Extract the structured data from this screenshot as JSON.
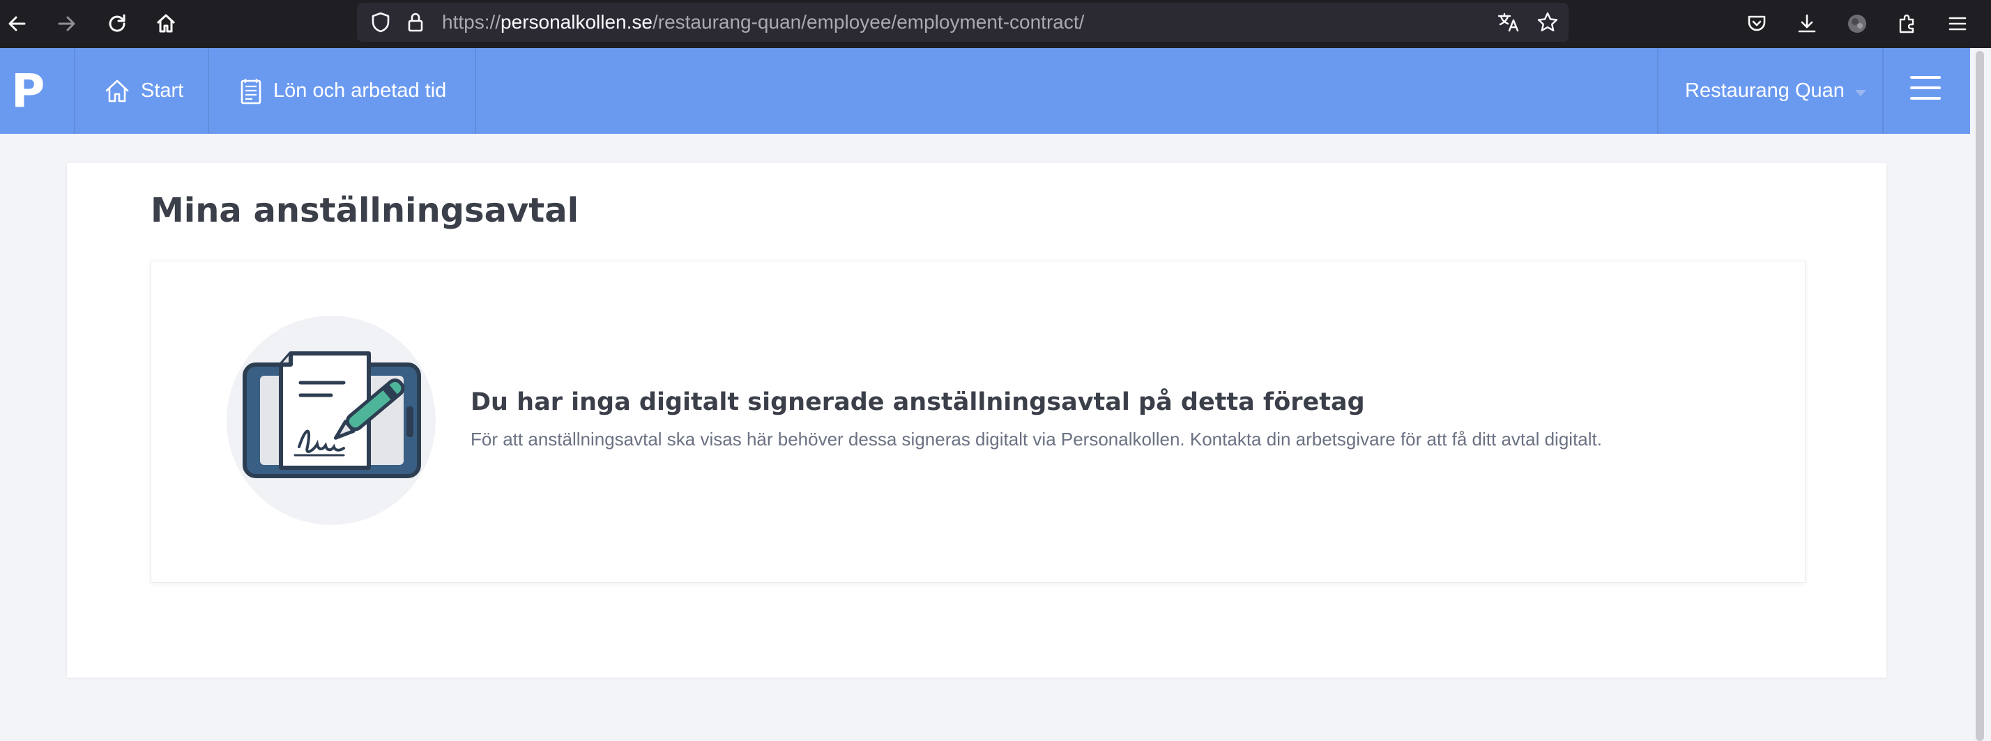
{
  "browser": {
    "url_scheme": "https://",
    "url_host": "personalkollen.se",
    "url_path": "/restaurang-quan/employee/employment-contract/"
  },
  "navbar": {
    "logo": "P",
    "items": [
      {
        "label": "Start",
        "icon": "home-icon"
      },
      {
        "label": "Lön och arbetad tid",
        "icon": "document-list-icon"
      }
    ],
    "company": "Restaurang Quan",
    "accent_color": "#6a9af0"
  },
  "main": {
    "title": "Mina anställningsavtal",
    "empty_state": {
      "title": "Du har inga digitalt signerade anställningsavtal på detta företag",
      "text": "För att anställningsavtal ska visas här behöver dessa signeras digitalt via Personalkollen. Kontakta din arbetsgivare för att få ditt avtal digitalt.",
      "illustration": "signed-contract-tablet-icon"
    }
  }
}
